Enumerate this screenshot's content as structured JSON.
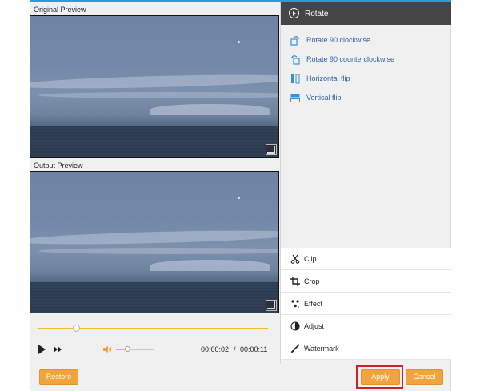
{
  "preview": {
    "original_label": "Original Preview",
    "output_label": "Output Preview"
  },
  "playback": {
    "progress": 0.17,
    "volume": 0.3,
    "current_time": "00:00:02",
    "separator": "/",
    "total_time": "00:00:11"
  },
  "sidebar": {
    "header_title": "Rotate",
    "rotate_options": [
      {
        "label": "Rotate 90 clockwise",
        "icon": "rotate-clockwise-icon"
      },
      {
        "label": "Rotate 90 counterclockwise",
        "icon": "rotate-counterclockwise-icon"
      },
      {
        "label": "Horizontal flip",
        "icon": "horizontal-flip-icon"
      },
      {
        "label": "Vertical flip",
        "icon": "vertical-flip-icon"
      }
    ],
    "tools": [
      {
        "label": "Clip",
        "icon": "scissors-icon"
      },
      {
        "label": "Crop",
        "icon": "crop-icon"
      },
      {
        "label": "Effect",
        "icon": "effect-icon"
      },
      {
        "label": "Adjust",
        "icon": "adjust-icon"
      },
      {
        "label": "Watermark",
        "icon": "brush-icon"
      }
    ]
  },
  "footer": {
    "restore_label": "Restore",
    "apply_label": "Apply",
    "cancel_label": "Cancel"
  },
  "colors": {
    "accent_orange": "#f0a43e",
    "link_blue": "#2f5fa6",
    "header_dark": "#454545",
    "highlight_red": "#c8232c",
    "top_accent": "#2b9be0"
  }
}
